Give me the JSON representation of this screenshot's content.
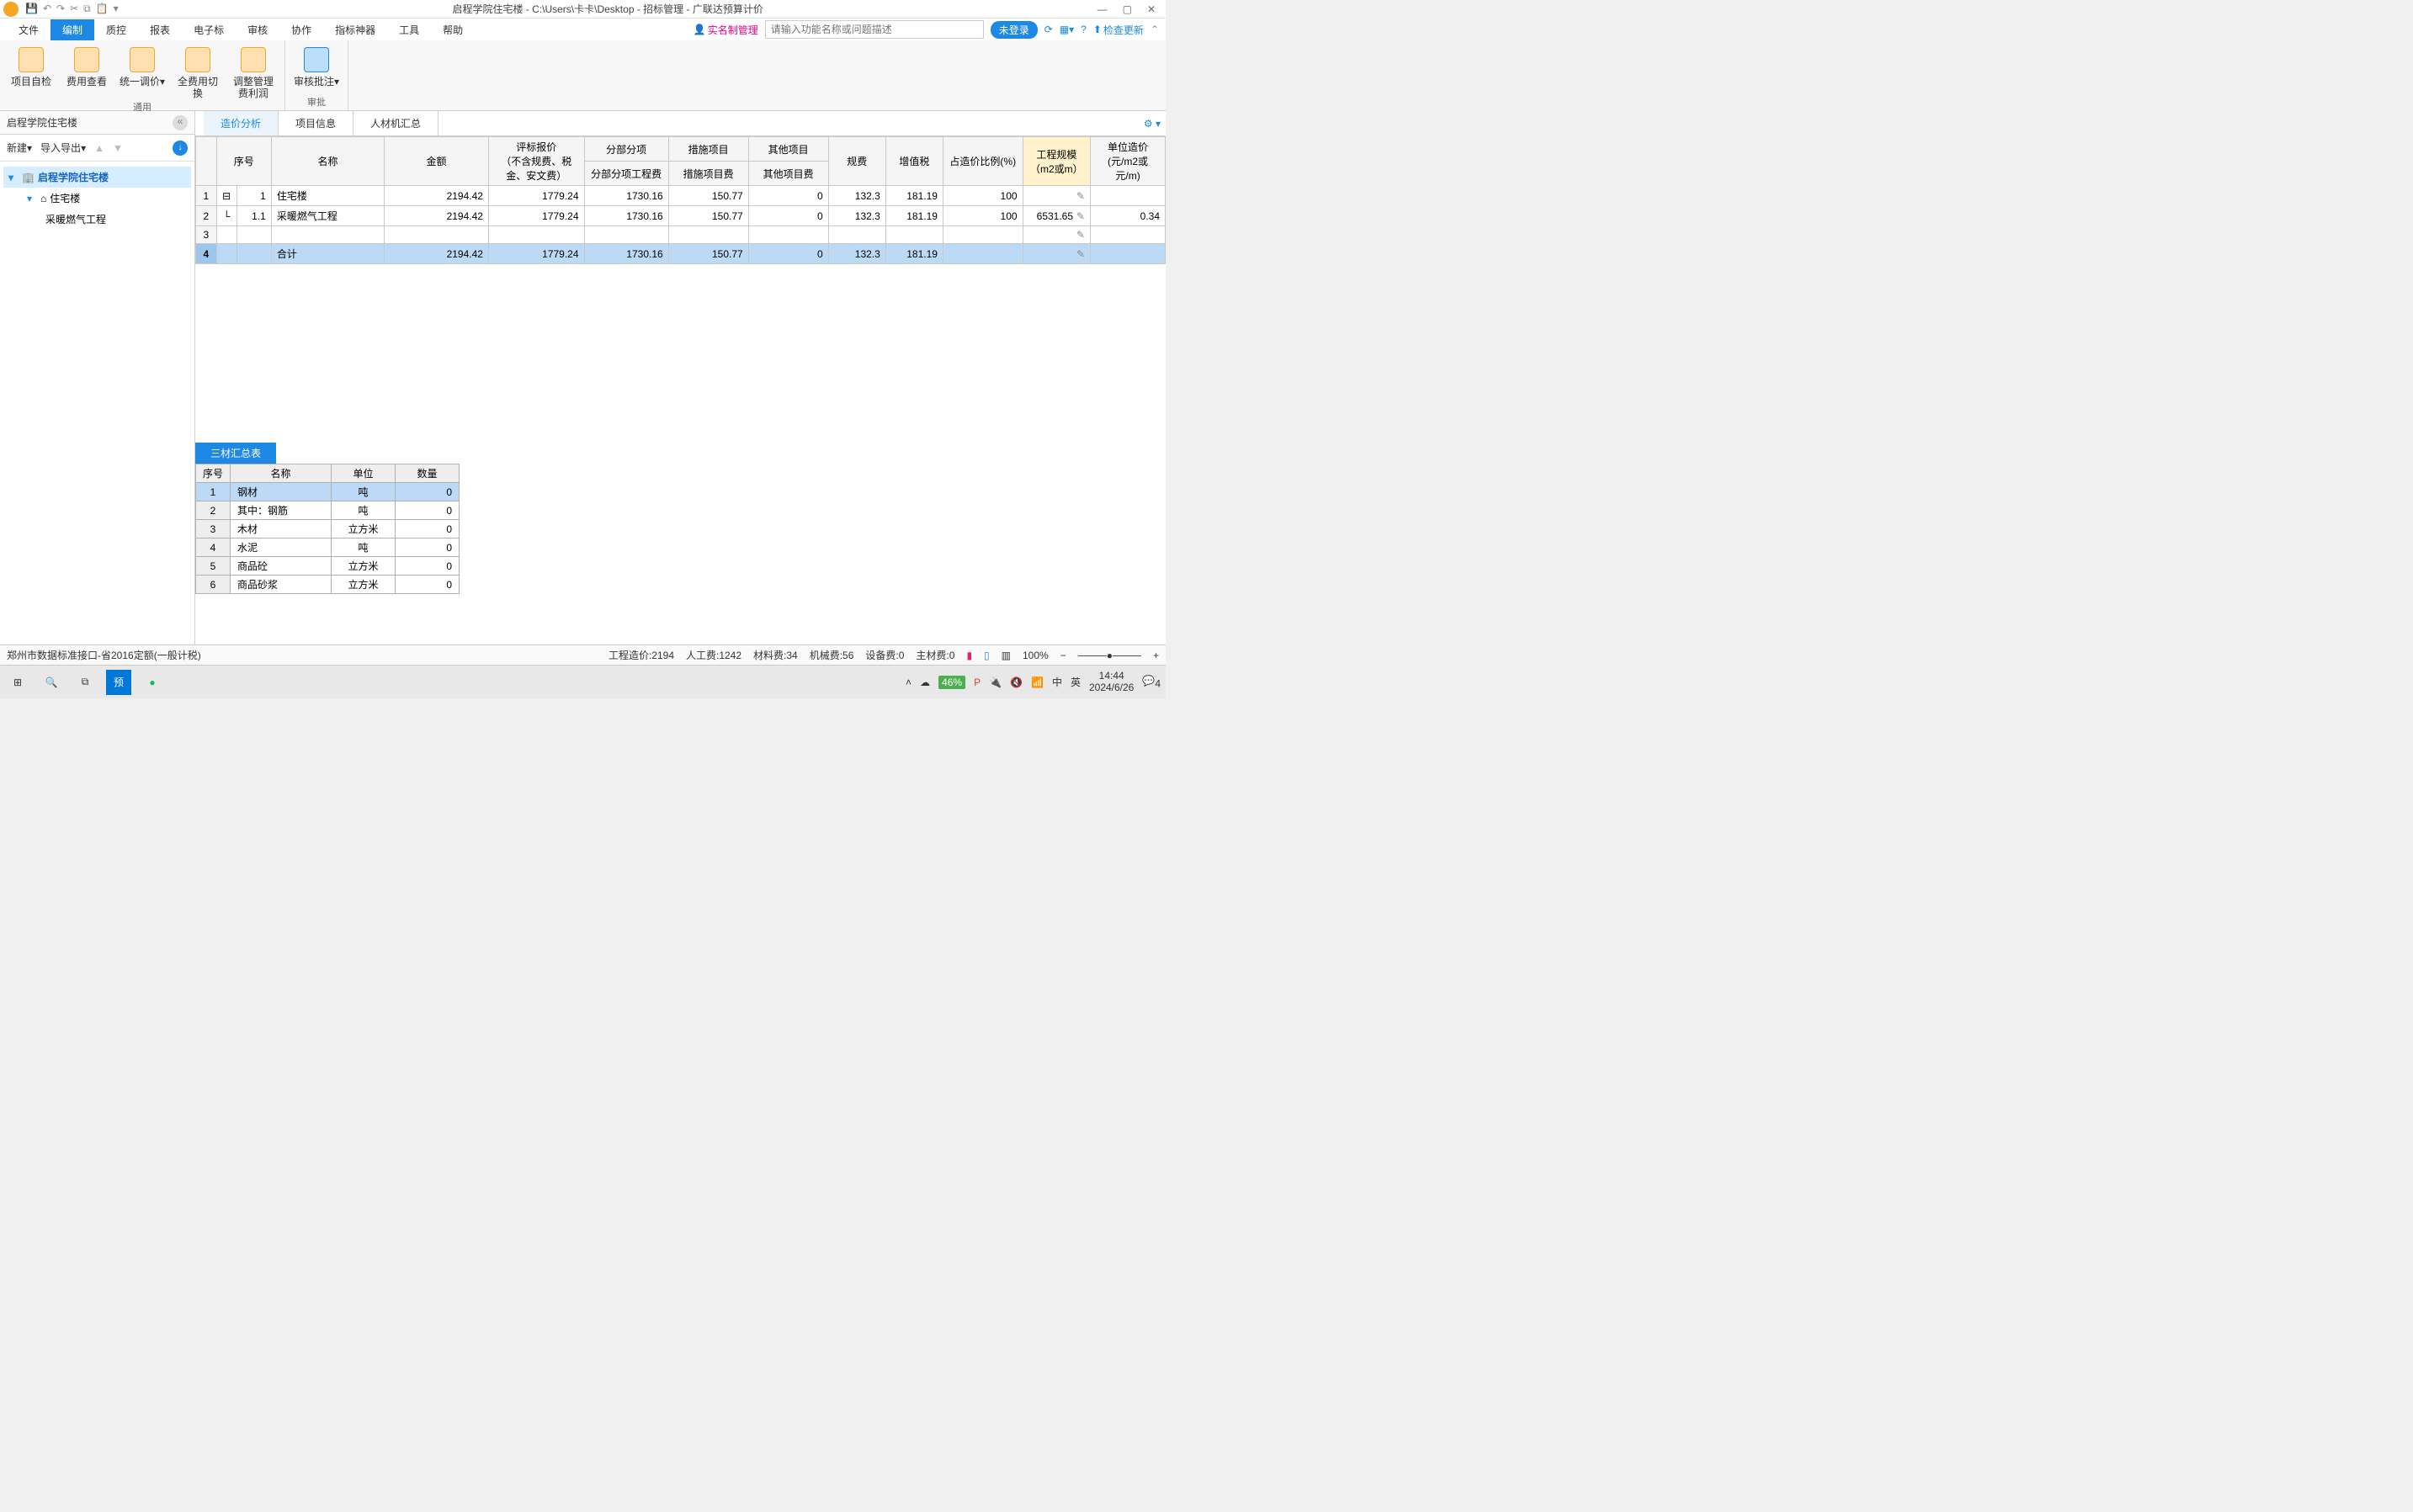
{
  "title": "启程学院住宅楼 - C:\\Users\\卡卡\\Desktop - 招标管理 - 广联达预算计价",
  "menu": {
    "file": "文件",
    "edit": "编制",
    "cost": "质控",
    "report": "报表",
    "ebid": "电子标",
    "review": "审核",
    "coop": "协作",
    "index": "指标神器",
    "tool": "工具",
    "help": "帮助"
  },
  "topright": {
    "realname": "实名制管理",
    "search_ph": "请输入功能名称或问题描述",
    "login": "未登录",
    "update": "检查更新"
  },
  "ribbon": {
    "g1": {
      "btns": [
        "项目自检",
        "费用查看",
        "统一调价",
        "全费用切换",
        "调整管理费利润"
      ],
      "caption": "通用"
    },
    "g2": {
      "btns": [
        "审核批注"
      ],
      "caption": "审批"
    }
  },
  "crumb": "启程学院住宅楼",
  "sidetools": {
    "new": "新建",
    "io": "导入导出"
  },
  "tree": {
    "root": "启程学院住宅楼",
    "child1": "住宅楼",
    "child2": "采暖燃气工程"
  },
  "tabs": {
    "t1": "造价分析",
    "t2": "项目信息",
    "t3": "人材机汇总"
  },
  "headers": {
    "seq": "序号",
    "name": "名称",
    "amount": "金额",
    "bid": "评标报价\n（不含规费、税金、安文费）",
    "fbfx_g": "分部分项",
    "fbfx": "分部分项工程费",
    "csxm_g": "措施项目",
    "csxm": "措施项目费",
    "qtxm_g": "其他项目",
    "qtxm": "其他项目费",
    "gf": "规费",
    "zzs": "增值税",
    "ratio": "占造价比例(%)",
    "scale": "工程规模\n（m2或m）",
    "unit": "单位造价\n(元/m2或元/m)"
  },
  "rows": [
    {
      "rn": "1",
      "seq": "1",
      "name": "住宅楼",
      "amount": "2194.42",
      "bid": "1779.24",
      "fbfx": "1730.16",
      "csxm": "150.77",
      "qtxm": "0",
      "gf": "132.3",
      "zzs": "181.19",
      "ratio": "100",
      "scale": "",
      "unit": ""
    },
    {
      "rn": "2",
      "seq": "1.1",
      "name": "采暖燃气工程",
      "amount": "2194.42",
      "bid": "1779.24",
      "fbfx": "1730.16",
      "csxm": "150.77",
      "qtxm": "0",
      "gf": "132.3",
      "zzs": "181.19",
      "ratio": "100",
      "scale": "6531.65",
      "unit": "0.34"
    },
    {
      "rn": "3",
      "seq": "",
      "name": "",
      "amount": "",
      "bid": "",
      "fbfx": "",
      "csxm": "",
      "qtxm": "",
      "gf": "",
      "zzs": "",
      "ratio": "",
      "scale": "",
      "unit": ""
    },
    {
      "rn": "4",
      "seq": "",
      "name": "合计",
      "amount": "2194.42",
      "bid": "1779.24",
      "fbfx": "1730.16",
      "csxm": "150.77",
      "qtxm": "0",
      "gf": "132.3",
      "zzs": "181.19",
      "ratio": "",
      "scale": "",
      "unit": ""
    }
  ],
  "btab": "三材汇总表",
  "bheaders": {
    "seq": "序号",
    "name": "名称",
    "unit": "单位",
    "qty": "数量"
  },
  "brows": [
    {
      "rn": "1",
      "name": "钢材",
      "unit": "吨",
      "qty": "0"
    },
    {
      "rn": "2",
      "name": "其中：钢筋",
      "unit": "吨",
      "qty": "0"
    },
    {
      "rn": "3",
      "name": "木材",
      "unit": "立方米",
      "qty": "0"
    },
    {
      "rn": "4",
      "name": "水泥",
      "unit": "吨",
      "qty": "0"
    },
    {
      "rn": "5",
      "name": "商品砼",
      "unit": "立方米",
      "qty": "0"
    },
    {
      "rn": "6",
      "name": "商品砂浆",
      "unit": "立方米",
      "qty": "0"
    }
  ],
  "status": {
    "left": "郑州市数据标准接口-省2016定额(一般计税)",
    "s1": "工程造价:2194",
    "s2": "人工费:1242",
    "s3": "材料费:34",
    "s4": "机械费:56",
    "s5": "设备费:0",
    "s6": "主材费:0",
    "zoom": "100%"
  },
  "taskbar": {
    "battery": "46%",
    "ime1": "中",
    "ime2": "英",
    "time": "14:44",
    "date": "2024/6/26",
    "notif": "4"
  }
}
